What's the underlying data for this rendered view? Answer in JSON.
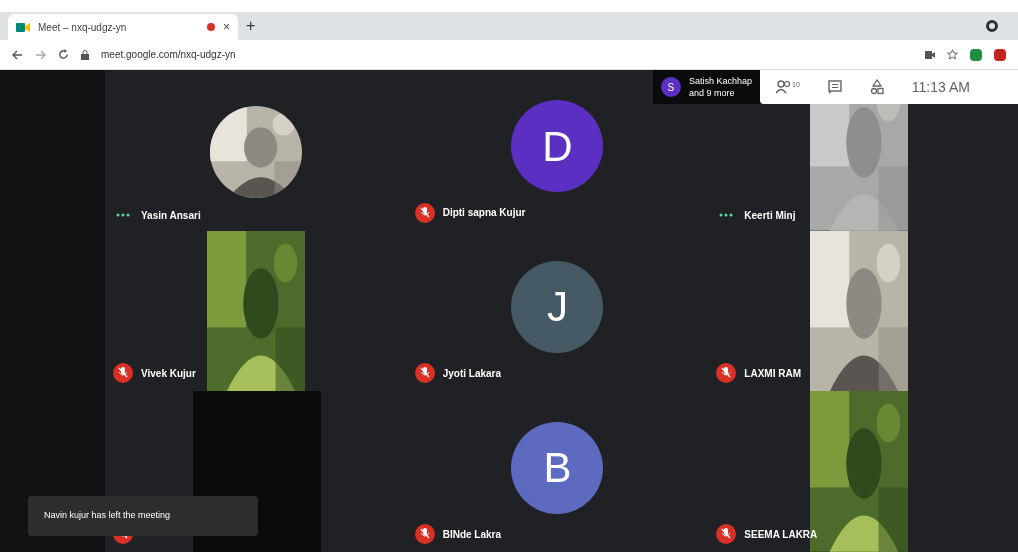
{
  "browser": {
    "tab_title": "Meet – nxq-udgz-yn",
    "close": "×",
    "new_tab": "+",
    "url": "meet.google.com/nxq-udgz-yn"
  },
  "participants_chip": {
    "initial": "S",
    "line1": "Satish Kachhap",
    "line2": "and 9 more"
  },
  "toolbar": {
    "people_count": "10",
    "time": "11:13 AM"
  },
  "tiles": [
    {
      "name": "Yasin Ansari",
      "muted": false
    },
    {
      "name": "Dipti sapna Kujur",
      "muted": true,
      "kind": "avatar",
      "initial": "D",
      "color": "#5b2fc2"
    },
    {
      "name": "Keerti Minj",
      "muted": false,
      "kind": "video"
    },
    {
      "name": "Vivek Kujur",
      "muted": true,
      "kind": "video"
    },
    {
      "name": "Jyoti Lakara",
      "muted": true,
      "kind": "avatar",
      "initial": "J",
      "color": "#455a64"
    },
    {
      "name": "LAXMI RAM",
      "muted": true,
      "kind": "video"
    },
    {
      "muted": true,
      "kind": "blank"
    },
    {
      "name": "BINde Lakra",
      "muted": true,
      "kind": "avatar",
      "initial": "B",
      "color": "#5c6bc0"
    },
    {
      "name": "SEEMA LAKRA",
      "muted": true,
      "kind": "video"
    }
  ],
  "toast": "Navin kujur has left the meeting"
}
